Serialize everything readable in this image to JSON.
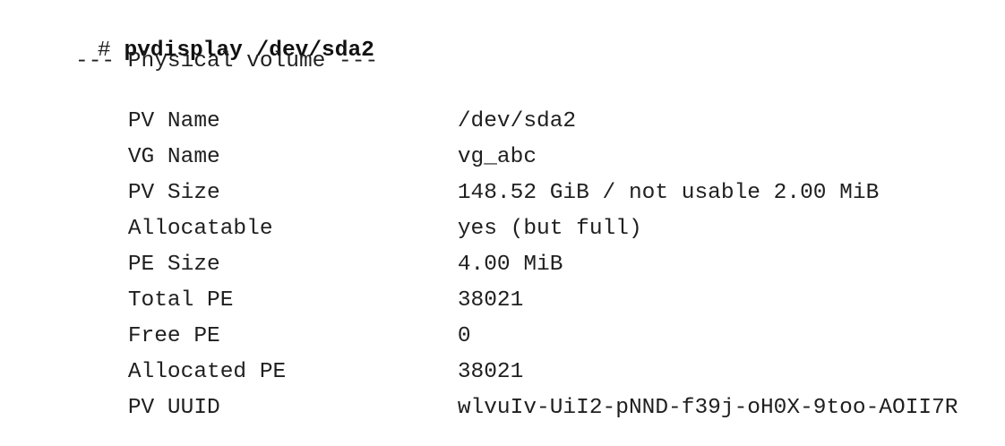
{
  "prompt": {
    "symbol": "#",
    "command": "pvdisplay /dev/sda2"
  },
  "header": "--- Physical volume ---",
  "fields": [
    {
      "label": "PV Name",
      "value": "/dev/sda2"
    },
    {
      "label": "VG Name",
      "value": "vg_abc"
    },
    {
      "label": "PV Size",
      "value": "148.52 GiB / not usable 2.00 MiB"
    },
    {
      "label": "Allocatable",
      "value": "yes (but full)"
    },
    {
      "label": "PE Size",
      "value": "4.00 MiB"
    },
    {
      "label": "Total PE",
      "value": "38021"
    },
    {
      "label": "Free PE",
      "value": "0"
    },
    {
      "label": "Allocated PE",
      "value": "38021"
    },
    {
      "label": "PV UUID",
      "value": "wlvuIv-UiI2-pNND-f39j-oH0X-9too-AOII7R"
    }
  ]
}
